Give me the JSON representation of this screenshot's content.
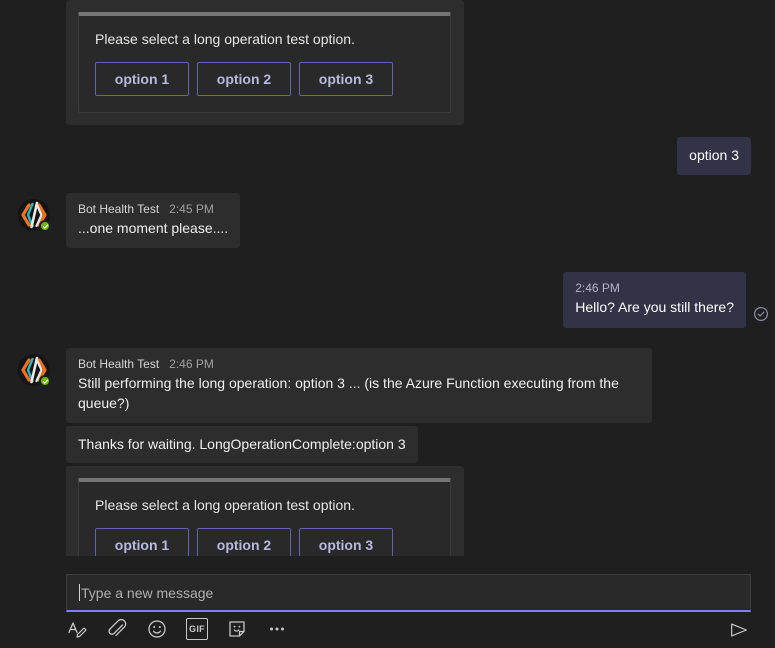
{
  "theme": {
    "page_bg": "#1f1f1f",
    "bot_bubble_bg": "#2d2d2d",
    "user_bubble_bg": "#333348",
    "card_bg": "#292929",
    "card_header_bar": "#767676",
    "accent_purple": "#6264a7",
    "focus_underline": "#7b83eb",
    "presence_green": "#6bb700"
  },
  "bot": {
    "name": "Bot Health Test",
    "avatar_icon": "code-brackets-avatar",
    "presence_status": "available"
  },
  "card": {
    "prompt": "Please select a long operation test option.",
    "options": [
      {
        "label": "option 1"
      },
      {
        "label": "option 2"
      },
      {
        "label": "option 3"
      }
    ]
  },
  "messages": [
    {
      "id": "m1",
      "type": "card",
      "from": "bot",
      "show_avatar": false
    },
    {
      "id": "m2",
      "type": "text",
      "from": "user",
      "text": "option 3",
      "time": "",
      "show_time": false,
      "show_receipt": false
    },
    {
      "id": "m3",
      "type": "text",
      "from": "bot",
      "sender": "Bot Health Test",
      "time": "2:45 PM",
      "text": "...one moment please....",
      "show_avatar": true
    },
    {
      "id": "m4",
      "type": "text",
      "from": "user",
      "time": "2:46 PM",
      "text": "Hello? Are you still there?",
      "show_time": true,
      "show_receipt": true,
      "receipt_icon": "check-circle-icon"
    },
    {
      "id": "m5",
      "type": "text",
      "from": "bot",
      "sender": "Bot Health Test",
      "time": "2:46 PM",
      "text": "Still performing the long operation: option 3 ... (is the Azure Function executing from the queue?)",
      "show_avatar": true
    },
    {
      "id": "m6",
      "type": "text",
      "from": "bot",
      "text": "Thanks for waiting. LongOperationComplete:option 3",
      "show_avatar": false,
      "compact": true
    },
    {
      "id": "m7",
      "type": "card",
      "from": "bot",
      "show_avatar": false
    }
  ],
  "composer": {
    "placeholder": "Type a new message",
    "value": "",
    "tools": [
      {
        "name": "format-icon",
        "label": "Format"
      },
      {
        "name": "attach-icon",
        "label": "Attach"
      },
      {
        "name": "emoji-icon",
        "label": "Emoji"
      },
      {
        "name": "gif-icon",
        "label": "GIF"
      },
      {
        "name": "sticker-icon",
        "label": "Sticker"
      },
      {
        "name": "more-options-icon",
        "label": "More options"
      }
    ],
    "gif_label": "GIF",
    "send_label": "Send",
    "send_icon": "send-arrow-icon"
  }
}
